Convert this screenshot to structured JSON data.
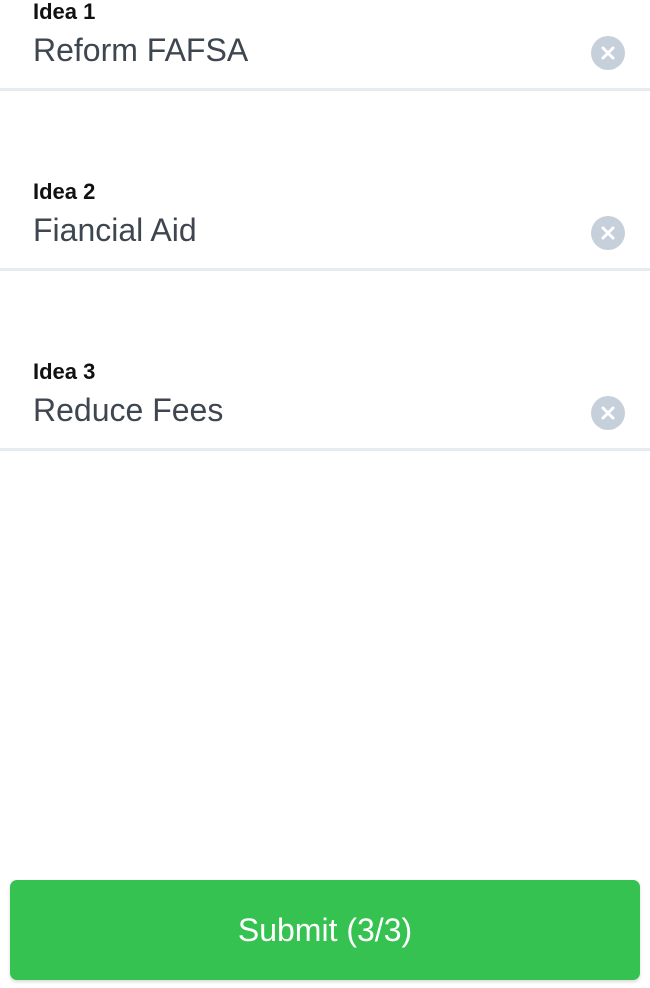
{
  "ideas": [
    {
      "label": "Idea 1",
      "value": "Reform FAFSA"
    },
    {
      "label": "Idea 2",
      "value": "Fiancial Aid"
    },
    {
      "label": "Idea 3",
      "value": "Reduce Fees"
    }
  ],
  "submit": {
    "label": "Submit (3/3)"
  },
  "icons": {
    "clear": "close-circle-icon"
  },
  "colors": {
    "submit_bg": "#35c251",
    "clear_icon_bg": "#c6d0da",
    "divider": "#e6ebef",
    "value_text": "#3e4650"
  }
}
